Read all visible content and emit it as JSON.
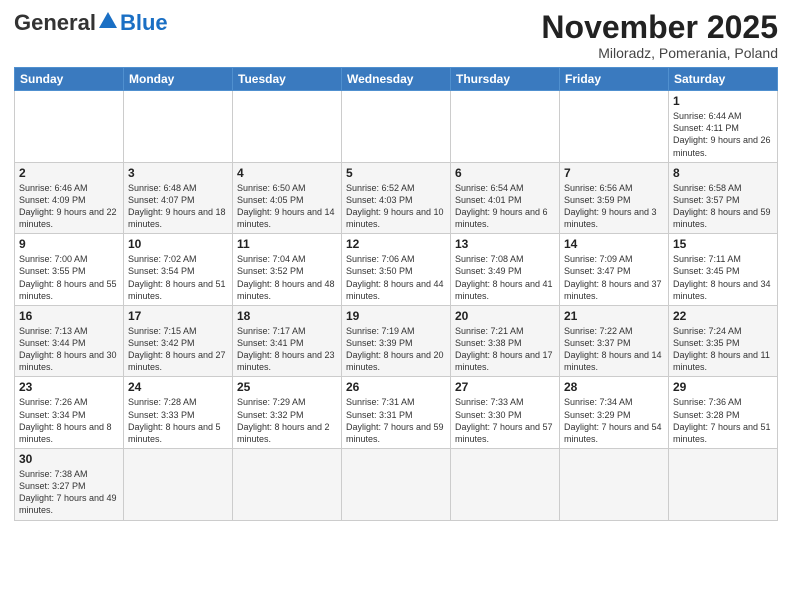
{
  "header": {
    "logo_general": "General",
    "logo_blue": "Blue",
    "title": "November 2025",
    "subtitle": "Miloradz, Pomerania, Poland"
  },
  "days_of_week": [
    "Sunday",
    "Monday",
    "Tuesday",
    "Wednesday",
    "Thursday",
    "Friday",
    "Saturday"
  ],
  "weeks": [
    [
      {
        "day": "",
        "info": ""
      },
      {
        "day": "",
        "info": ""
      },
      {
        "day": "",
        "info": ""
      },
      {
        "day": "",
        "info": ""
      },
      {
        "day": "",
        "info": ""
      },
      {
        "day": "",
        "info": ""
      },
      {
        "day": "1",
        "info": "Sunrise: 6:44 AM\nSunset: 4:11 PM\nDaylight: 9 hours and 26 minutes."
      }
    ],
    [
      {
        "day": "2",
        "info": "Sunrise: 6:46 AM\nSunset: 4:09 PM\nDaylight: 9 hours and 22 minutes."
      },
      {
        "day": "3",
        "info": "Sunrise: 6:48 AM\nSunset: 4:07 PM\nDaylight: 9 hours and 18 minutes."
      },
      {
        "day": "4",
        "info": "Sunrise: 6:50 AM\nSunset: 4:05 PM\nDaylight: 9 hours and 14 minutes."
      },
      {
        "day": "5",
        "info": "Sunrise: 6:52 AM\nSunset: 4:03 PM\nDaylight: 9 hours and 10 minutes."
      },
      {
        "day": "6",
        "info": "Sunrise: 6:54 AM\nSunset: 4:01 PM\nDaylight: 9 hours and 6 minutes."
      },
      {
        "day": "7",
        "info": "Sunrise: 6:56 AM\nSunset: 3:59 PM\nDaylight: 9 hours and 3 minutes."
      },
      {
        "day": "8",
        "info": "Sunrise: 6:58 AM\nSunset: 3:57 PM\nDaylight: 8 hours and 59 minutes."
      }
    ],
    [
      {
        "day": "9",
        "info": "Sunrise: 7:00 AM\nSunset: 3:55 PM\nDaylight: 8 hours and 55 minutes."
      },
      {
        "day": "10",
        "info": "Sunrise: 7:02 AM\nSunset: 3:54 PM\nDaylight: 8 hours and 51 minutes."
      },
      {
        "day": "11",
        "info": "Sunrise: 7:04 AM\nSunset: 3:52 PM\nDaylight: 8 hours and 48 minutes."
      },
      {
        "day": "12",
        "info": "Sunrise: 7:06 AM\nSunset: 3:50 PM\nDaylight: 8 hours and 44 minutes."
      },
      {
        "day": "13",
        "info": "Sunrise: 7:08 AM\nSunset: 3:49 PM\nDaylight: 8 hours and 41 minutes."
      },
      {
        "day": "14",
        "info": "Sunrise: 7:09 AM\nSunset: 3:47 PM\nDaylight: 8 hours and 37 minutes."
      },
      {
        "day": "15",
        "info": "Sunrise: 7:11 AM\nSunset: 3:45 PM\nDaylight: 8 hours and 34 minutes."
      }
    ],
    [
      {
        "day": "16",
        "info": "Sunrise: 7:13 AM\nSunset: 3:44 PM\nDaylight: 8 hours and 30 minutes."
      },
      {
        "day": "17",
        "info": "Sunrise: 7:15 AM\nSunset: 3:42 PM\nDaylight: 8 hours and 27 minutes."
      },
      {
        "day": "18",
        "info": "Sunrise: 7:17 AM\nSunset: 3:41 PM\nDaylight: 8 hours and 23 minutes."
      },
      {
        "day": "19",
        "info": "Sunrise: 7:19 AM\nSunset: 3:39 PM\nDaylight: 8 hours and 20 minutes."
      },
      {
        "day": "20",
        "info": "Sunrise: 7:21 AM\nSunset: 3:38 PM\nDaylight: 8 hours and 17 minutes."
      },
      {
        "day": "21",
        "info": "Sunrise: 7:22 AM\nSunset: 3:37 PM\nDaylight: 8 hours and 14 minutes."
      },
      {
        "day": "22",
        "info": "Sunrise: 7:24 AM\nSunset: 3:35 PM\nDaylight: 8 hours and 11 minutes."
      }
    ],
    [
      {
        "day": "23",
        "info": "Sunrise: 7:26 AM\nSunset: 3:34 PM\nDaylight: 8 hours and 8 minutes."
      },
      {
        "day": "24",
        "info": "Sunrise: 7:28 AM\nSunset: 3:33 PM\nDaylight: 8 hours and 5 minutes."
      },
      {
        "day": "25",
        "info": "Sunrise: 7:29 AM\nSunset: 3:32 PM\nDaylight: 8 hours and 2 minutes."
      },
      {
        "day": "26",
        "info": "Sunrise: 7:31 AM\nSunset: 3:31 PM\nDaylight: 7 hours and 59 minutes."
      },
      {
        "day": "27",
        "info": "Sunrise: 7:33 AM\nSunset: 3:30 PM\nDaylight: 7 hours and 57 minutes."
      },
      {
        "day": "28",
        "info": "Sunrise: 7:34 AM\nSunset: 3:29 PM\nDaylight: 7 hours and 54 minutes."
      },
      {
        "day": "29",
        "info": "Sunrise: 7:36 AM\nSunset: 3:28 PM\nDaylight: 7 hours and 51 minutes."
      }
    ],
    [
      {
        "day": "30",
        "info": "Sunrise: 7:38 AM\nSunset: 3:27 PM\nDaylight: 7 hours and 49 minutes."
      },
      {
        "day": "",
        "info": ""
      },
      {
        "day": "",
        "info": ""
      },
      {
        "day": "",
        "info": ""
      },
      {
        "day": "",
        "info": ""
      },
      {
        "day": "",
        "info": ""
      },
      {
        "day": "",
        "info": ""
      }
    ]
  ]
}
